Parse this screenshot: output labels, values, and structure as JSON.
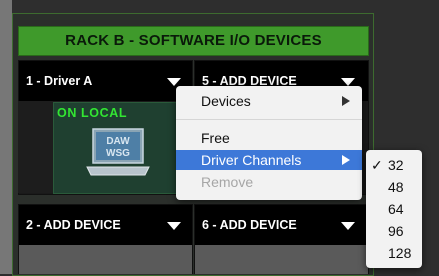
{
  "rack": {
    "title": "RACK B - SOFTWARE I/O DEVICES",
    "slots": [
      {
        "label": "1 - Driver A"
      },
      {
        "label": "5 - ADD DEVICE"
      },
      {
        "label": "2 - ADD DEVICE"
      },
      {
        "label": "6 - ADD DEVICE"
      }
    ],
    "status": "ON LOCAL",
    "device_logo": {
      "line1": "DAW",
      "line2": "WSG"
    }
  },
  "context_menu": {
    "items": [
      {
        "label": "Devices",
        "has_submenu": true
      },
      {
        "label": "Free"
      },
      {
        "label": "Driver Channels",
        "has_submenu": true,
        "highlighted": true
      },
      {
        "label": "Remove",
        "disabled": true
      }
    ]
  },
  "submenu": {
    "options": [
      "32",
      "48",
      "64",
      "96",
      "128"
    ],
    "selected": "32",
    "check_glyph": "✓"
  },
  "colors": {
    "header_green": "#3f9a2b",
    "status_green": "#32e632",
    "highlight_blue": "#3d78d8"
  }
}
